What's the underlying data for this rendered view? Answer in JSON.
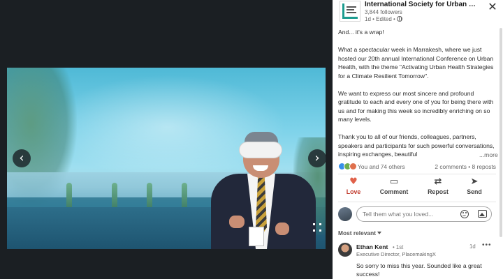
{
  "post": {
    "author": "International Society for Urban Health",
    "followers": "3,844 followers",
    "meta": "1d • Edited •",
    "paragraphs": [
      "And... it's a wrap!",
      "What a spectacular week in Marrakesh, where we just hosted our 20th annual International Conference on Urban Health, with the theme \"Activating Urban Health Strategies for a Climate Resilient Tomorrow\".",
      "We want to express our most sincere and profound gratitude to each and every one of you for being there with us and for making this week so incredibly enriching on so many levels.",
      "Thank you to all of our friends, colleagues, partners, speakers and participants for such powerful conversations, inspiring exchanges, beautiful"
    ],
    "more_label": "...more"
  },
  "reactions": {
    "summary": "You and 74 others",
    "counts": "2 comments • 8 reposts"
  },
  "actions": [
    {
      "label": "Love",
      "icon": "heart-icon"
    },
    {
      "label": "Comment",
      "icon": "comment-icon"
    },
    {
      "label": "Repost",
      "icon": "repost-icon"
    },
    {
      "label": "Send",
      "icon": "send-icon"
    }
  ],
  "composer": {
    "placeholder": "Tell them what you loved..."
  },
  "sort": {
    "label": "Most relevant"
  },
  "comment": {
    "name": "Ethan Kent",
    "degree": "• 1st",
    "title": "Executive Director, PlacemakingX",
    "time": "1d",
    "menu": "•••",
    "text": "So sorry to miss this year. Sounded like a great success!"
  },
  "viewer": {
    "prev_icon": "‹",
    "next_icon": "›"
  },
  "colors": {
    "love": "#c0392b",
    "brand_teal": "#1c9c8f",
    "link": "#0a66c2"
  }
}
